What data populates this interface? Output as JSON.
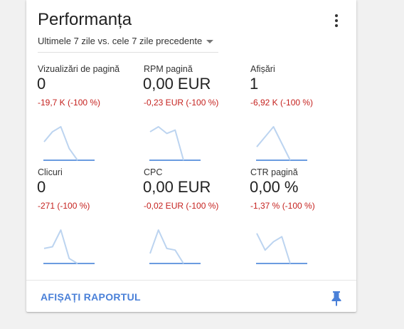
{
  "card": {
    "title": "Performanța",
    "date_range": "Ultimele 7 zile vs. cele 7 zile precedente",
    "menu_icon": "more-vert-icon",
    "footer_link": "AFIȘAȚI RAPORTUL",
    "pin_icon": "pin-icon"
  },
  "colors": {
    "accent": "#4a80d8",
    "negative": "#c5221f",
    "sparkline": "#bcd4f0",
    "baseline": "#3a7bd5"
  },
  "metrics": [
    {
      "label": "Vizualizări de pagină",
      "value": "0",
      "delta": "-19,7 K (-100 %)",
      "trend": [
        0.55,
        0.85,
        1.0,
        0.35,
        0.0
      ]
    },
    {
      "label": "RPM pagină",
      "value": "0,00 EUR",
      "delta": "-0,23 EUR (-100 %)",
      "trend": [
        0.85,
        1.0,
        0.8,
        0.9,
        0.0
      ]
    },
    {
      "label": "Afișări",
      "value": "1",
      "delta": "-6,92 K (-100 %)",
      "trend": [
        0.4,
        0.7,
        1.0,
        0.5,
        0.0
      ]
    },
    {
      "label": "Clicuri",
      "value": "0",
      "delta": "-271 (-100 %)",
      "trend": [
        0.45,
        0.5,
        1.0,
        0.15,
        0.0
      ]
    },
    {
      "label": "CPC",
      "value": "0,00 EUR",
      "delta": "-0,02 EUR (-100 %)",
      "trend": [
        0.3,
        1.0,
        0.45,
        0.4,
        0.0
      ]
    },
    {
      "label": "CTR pagină",
      "value": "0,00 %",
      "delta": "-1,37 % (-100 %)",
      "trend": [
        0.9,
        0.4,
        0.65,
        0.8,
        0.0
      ]
    }
  ]
}
